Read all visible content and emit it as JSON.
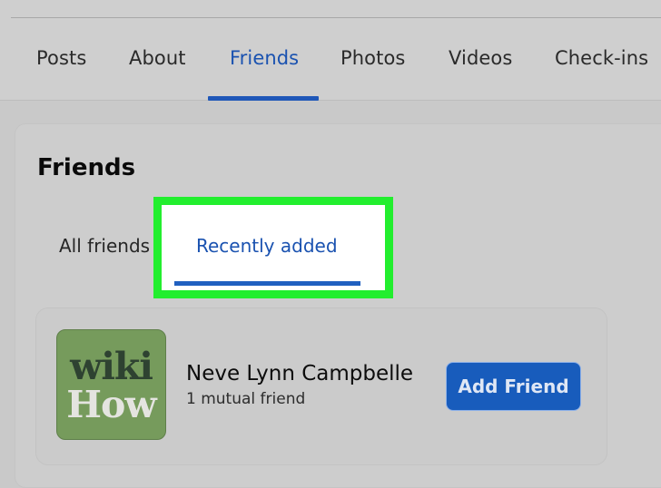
{
  "profile_nav": {
    "tabs": [
      {
        "label": "Posts",
        "active": false
      },
      {
        "label": "About",
        "active": false
      },
      {
        "label": "Friends",
        "active": true
      },
      {
        "label": "Photos",
        "active": false
      },
      {
        "label": "Videos",
        "active": false
      },
      {
        "label": "Check-ins",
        "active": false
      }
    ]
  },
  "friends_section": {
    "title": "Friends",
    "subtabs": [
      {
        "label": "All friends",
        "active": false
      },
      {
        "label": "Recently added",
        "active": true,
        "highlighted": true
      }
    ]
  },
  "friends_list": [
    {
      "avatar_icon": "wikihow-logo",
      "avatar_text_top": "wiki",
      "avatar_text_bottom": "How",
      "name": "Neve Lynn Campbelle",
      "mutual": "1 mutual friend",
      "action_label": "Add Friend"
    }
  ],
  "colors": {
    "accent": "#1a52b0",
    "button": "#185cbc",
    "highlight": "#22ee2e",
    "avatar_bg": "#769b5c"
  }
}
